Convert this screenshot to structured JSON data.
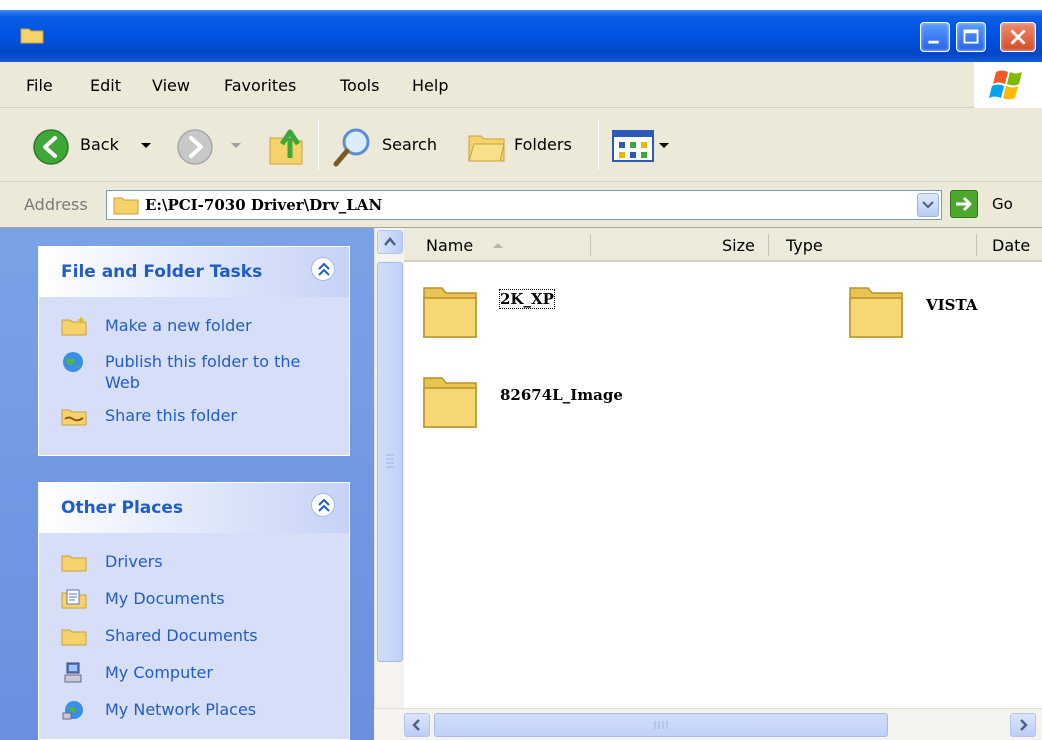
{
  "menu": [
    "File",
    "Edit",
    "View",
    "Favorites",
    "Tools",
    "Help"
  ],
  "toolbar": {
    "back_label": "Back",
    "search_label": "Search",
    "folders_label": "Folders"
  },
  "address": {
    "label": "Address",
    "path": "E:\\PCI-7030 Driver\\Drv_LAN",
    "go_label": "Go"
  },
  "tasks": {
    "title": "File and Folder Tasks",
    "items": [
      "Make a new folder",
      "Publish this folder to the Web",
      "Share this folder"
    ]
  },
  "other_places": {
    "title": "Other Places",
    "items": [
      "Drivers",
      "My Documents",
      "Shared Documents",
      "My Computer",
      "My Network Places"
    ]
  },
  "columns": [
    "Name",
    "Size",
    "Type",
    "Date"
  ],
  "folders": [
    "2K_XP",
    "VISTA",
    "82674L_Image"
  ],
  "colors": {
    "titlebar": "#0054e3",
    "taskpane": "#7ba2e7",
    "link": "#215dc6",
    "folder": "#f7d774"
  }
}
